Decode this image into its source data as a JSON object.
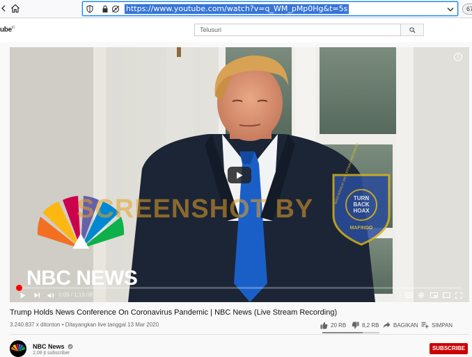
{
  "browser": {
    "url": "https://www.youtube.com/watch?v=q_WM_pMp0Hg&t=5s",
    "zoom_badge": "67"
  },
  "youtube": {
    "logo_text": "ube",
    "logo_suffix": "ID",
    "search": {
      "placeholder": "Telusuri"
    }
  },
  "player": {
    "info_label": "i",
    "time_display": "0:05 / 1:19:08",
    "progress_fraction": 0.0011,
    "overlay_watermark": "SCREENSHOT BY",
    "logo_text": "NBC NEWS",
    "badge_text": {
      "arc_left": "MASYARAKAT ANTI FITNAH INDONESIA",
      "center": [
        "TURN",
        "BACK",
        "HOAX"
      ],
      "bottom": "MAFINDO"
    }
  },
  "video": {
    "title": "Trump Holds News Conference On Coronavirus Pandemic | NBC News (Live Stream Recording)",
    "views": "3.240.837 x ditonton",
    "stream_date": "• Ditayangkan live tanggal 13 Mar 2020",
    "likes": "20 RB",
    "dislikes": "8,2 RB",
    "share_label": "BAGIKAN",
    "save_label": "SIMPAN",
    "like_ratio": 0.71
  },
  "channel": {
    "name": "NBC News",
    "subscribers": "2,08 jt subscriber",
    "subscribe_label": "SUBSCRIBE"
  },
  "colors": {
    "accent_blue": "#0a84ff",
    "youtube_red": "#cc0000",
    "progress_red": "#ff0000"
  }
}
